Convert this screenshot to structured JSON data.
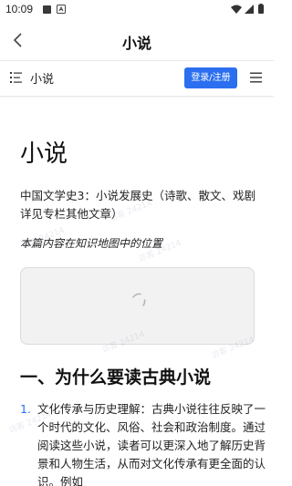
{
  "status_bar": {
    "time": "10:09"
  },
  "title_bar": {
    "title": "小说"
  },
  "header": {
    "site_label": "小说",
    "login_button": "登录/注册"
  },
  "article": {
    "title": "小说",
    "subtitle": "中国文学史3：小说发展史（诗歌、散文、戏剧详见专栏其他文章）",
    "map_caption": "本篇内容在知识地图中的位置",
    "section_heading": "一、为什么要读古典小说",
    "list_items": [
      {
        "number": "1.",
        "text": "文化传承与历史理解：古典小说往往反映了一个时代的文化、风俗、社会和政治制度。通过阅读这些小说，读者可以更深入地了解历史背景和人物生活，从而对文化传承有更全面的认识。例如"
      }
    ]
  },
  "watermark": {
    "text": "访客 24214"
  },
  "colors": {
    "accent": "#2b6ff0",
    "map_box_bg": "#f2f2f2"
  }
}
